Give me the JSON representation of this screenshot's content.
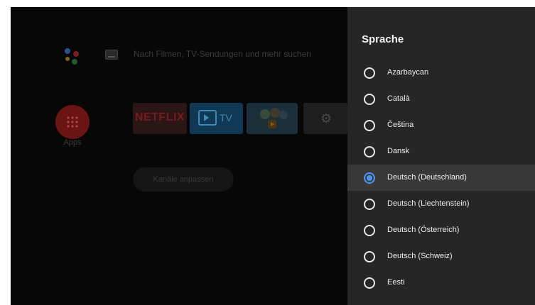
{
  "home": {
    "search_hint": "Nach Filmen, TV-Sendungen und mehr suchen",
    "apps_label": "Apps",
    "netflix_label": "NETFLIX",
    "tv_label": "TV",
    "channels_button": "Kanäle anpassen"
  },
  "panel": {
    "title": "Sprache",
    "options": [
      {
        "label": "Azarbaycan",
        "selected": false
      },
      {
        "label": "Català",
        "selected": false
      },
      {
        "label": "Čeština",
        "selected": false
      },
      {
        "label": "Dansk",
        "selected": false
      },
      {
        "label": "Deutsch (Deutschland)",
        "selected": true
      },
      {
        "label": "Deutsch (Liechtenstein)",
        "selected": false
      },
      {
        "label": "Deutsch (Österreich)",
        "selected": false
      },
      {
        "label": "Deutsch (Schweiz)",
        "selected": false
      },
      {
        "label": "Eesti",
        "selected": false
      }
    ]
  },
  "colors": {
    "accent": "#4e94f8",
    "panel_bg": "#262626",
    "selected_row_bg": "#383838"
  }
}
